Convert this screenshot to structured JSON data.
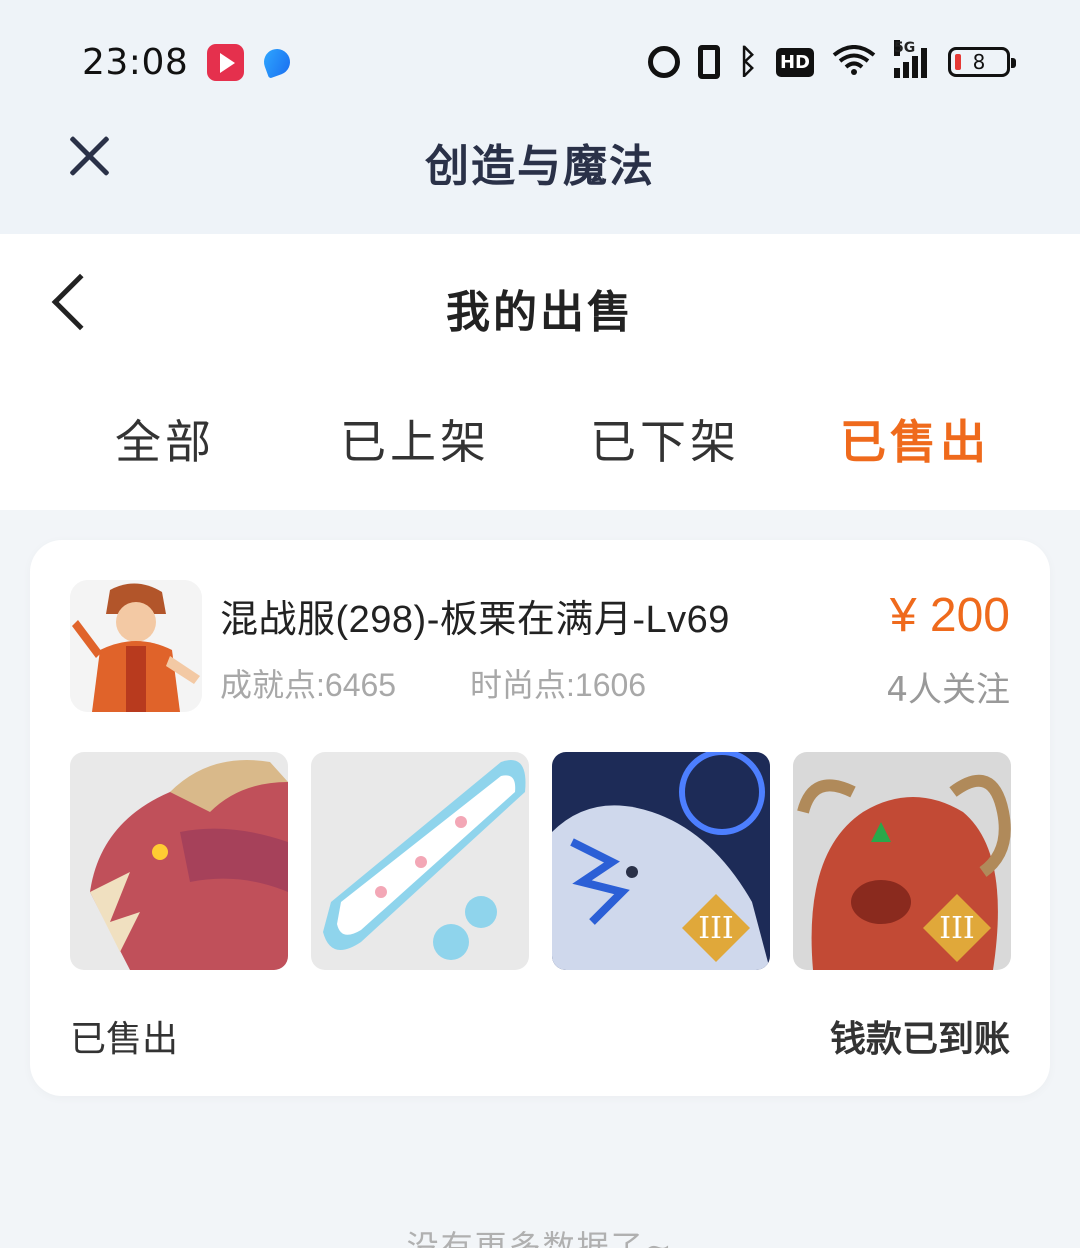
{
  "status_bar": {
    "time": "23:08",
    "battery_level": "8",
    "icons": [
      "video-app-icon",
      "browser-app-icon",
      "alarm-icon",
      "vibrate-icon",
      "bluetooth-icon",
      "hd-icon",
      "wifi-icon",
      "signal-5g-icon",
      "battery-icon"
    ],
    "network_label": "5G",
    "hd_label": "HD"
  },
  "app_header": {
    "title": "创造与魔法"
  },
  "page": {
    "title": "我的出售",
    "tabs": [
      {
        "label": "全部",
        "active": false
      },
      {
        "label": "已上架",
        "active": false
      },
      {
        "label": "已下架",
        "active": false
      },
      {
        "label": "已售出",
        "active": true
      }
    ]
  },
  "listing": {
    "title": "混战服(298)-板栗在满月-Lv69",
    "achievement": "成就点:6465",
    "fashion": "时尚点:1606",
    "price": "¥ 200",
    "followers": "4人关注",
    "thumbnails": [
      "dragon-mount-thumbnail",
      "skateboard-thumbnail",
      "ice-tiger-thumbnail",
      "red-bull-thumbnail"
    ],
    "rank_badge": "III",
    "status": "已售出",
    "payment_status": "钱款已到账"
  },
  "footer": {
    "no_more": "没有更多数据了~"
  },
  "colors": {
    "accent": "#ef6a1c",
    "header_bg": "#eef3f8",
    "title_dark": "#2a3148"
  }
}
